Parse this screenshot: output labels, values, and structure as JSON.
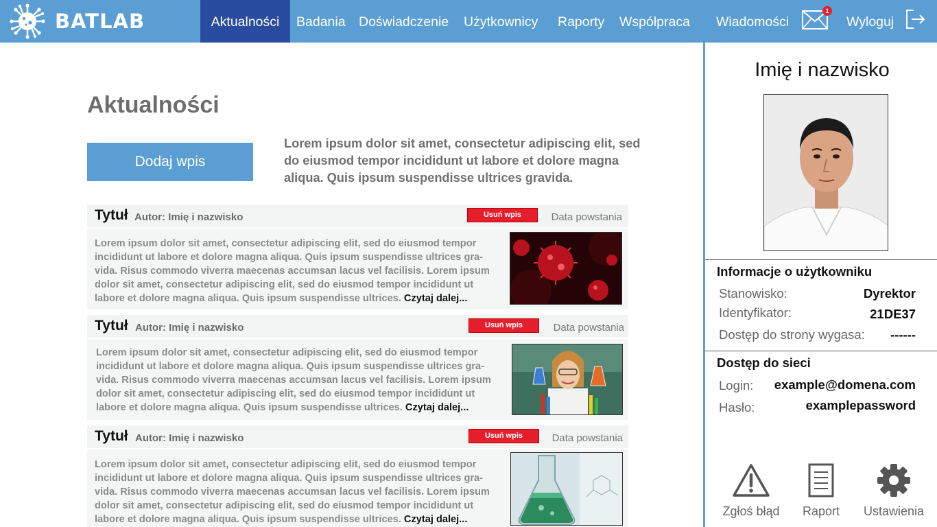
{
  "brand": {
    "name": "BATLAB",
    "logo_icon": "virus-logo-icon"
  },
  "nav": {
    "items": [
      {
        "label": "Aktualności",
        "active": true
      },
      {
        "label": "Badania",
        "active": false
      },
      {
        "label": "Doświadczenie",
        "active": false
      },
      {
        "label": "Użytkownicy",
        "active": false
      },
      {
        "label": "Raporty",
        "active": false
      },
      {
        "label": "Współpraca",
        "active": false
      }
    ],
    "messages_label": "Wiadomości",
    "messages_badge": "1",
    "logout_label": "Wyloguj"
  },
  "main": {
    "title": "Aktualności",
    "add_button": "Dodaj wpis",
    "intro": "Lorem ipsum dolor sit amet, consectetur adipiscing elit, sed do eiusmod tempor incididunt ut labore et dolore magna aliqua. Quis ipsum suspendisse ultrices gravida."
  },
  "posts": [
    {
      "title": "Tytuł",
      "author": "Autor: Imię i nazwisko",
      "delete_label": "Usuń wpis",
      "date": "Data powstania",
      "text": "Lorem ipsum dolor sit amet, consectetur adipiscing elit, sed do eiusmod tempor incididunt ut labore et dolore magna aliqua. Quis ipsum suspendisse ultrices gra-vida. Risus commodo viverra maecenas accumsan lacus vel facilisis. Lorem ipsum dolor sit amet, consectetur adipiscing elit, sed do eiusmod tempor incididunt ut labore et dolore magna aliqua. Quis ipsum suspendisse ultrices.",
      "read_more": "Czytaj dalej...",
      "image": "virus-image"
    },
    {
      "title": "Tytuł",
      "author": "Autor: Imię i nazwisko",
      "delete_label": "Usuń wpis",
      "date": "Data powstania",
      "text": "Lorem ipsum dolor sit amet, consectetur adipiscing elit, sed do eiusmod tempor incididunt ut labore et dolore magna aliqua. Quis ipsum suspendisse ultrices gra-vida. Risus commodo viverra maecenas accumsan lacus vel facilisis. Lorem ipsum dolor sit amet, consectetur adipiscing elit, sed do eiusmod tempor incididunt ut labore et dolore magna aliqua. Quis ipsum suspendisse ultrices.",
      "read_more": "Czytaj dalej...",
      "image": "scientist-image"
    },
    {
      "title": "Tytuł",
      "author": "Autor: Imię i nazwisko",
      "delete_label": "Usuń wpis",
      "date": "Data powstania",
      "text": "Lorem ipsum dolor sit amet, consectetur adipiscing elit, sed do eiusmod tempor incididunt ut labore et dolore magna aliqua. Quis ipsum suspendisse ultrices gra-vida. Risus commodo viverra maecenas accumsan lacus vel facilisis. Lorem ipsum dolor sit amet, consectetur adipiscing elit, sed do eiusmod tempor incididunt ut labore et dolore magna aliqua. Quis ipsum suspendisse ultrices.",
      "read_more": "Czytaj dalej...",
      "image": "flask-image"
    }
  ],
  "sidebar": {
    "name": "Imię i nazwisko",
    "user_info": {
      "title": "Informacje o użytkowniku",
      "position_label": "Stanowisko:",
      "position_value": "Dyrektor",
      "id_label": "Identyfikator:",
      "id_value": "21DE37",
      "expires_label": "Dostęp do strony wygasa:",
      "expires_value": "------"
    },
    "network": {
      "title": "Dostęp do sieci",
      "login_label": "Login:",
      "login_value": "example@domena.com",
      "password_label": "Hasło:",
      "password_value": "examplepassword"
    },
    "actions": [
      {
        "label": "Zgłoś błąd",
        "icon": "warning-icon"
      },
      {
        "label": "Raport",
        "icon": "report-icon"
      },
      {
        "label": "Ustawienia",
        "icon": "gear-icon"
      }
    ]
  },
  "colors": {
    "accent": "#5b9ed4",
    "nav_active": "#2a4ca0",
    "danger": "#e61e2c"
  }
}
